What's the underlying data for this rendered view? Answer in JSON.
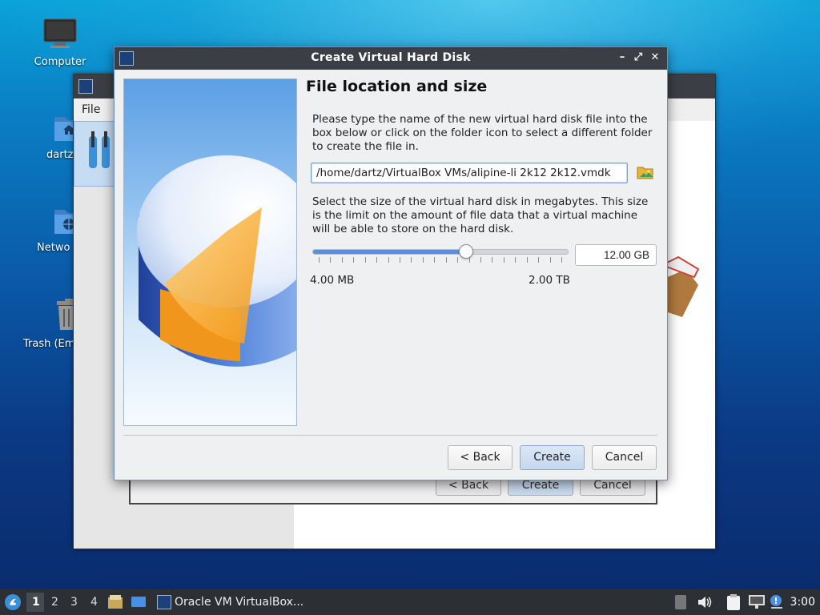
{
  "desktop": {
    "icons": [
      {
        "label": "Computer",
        "icon": "computer-icon"
      },
      {
        "label": "dartz",
        "icon": "home-folder-icon"
      },
      {
        "label": "Netwo",
        "icon": "network-folder-icon"
      },
      {
        "label": "Trash (Em",
        "icon": "trash-icon"
      }
    ]
  },
  "background_window": {
    "menu_file": "File",
    "back_label": "< Back",
    "create_label": "Create",
    "cancel_label": "Cancel"
  },
  "dialog": {
    "title": "Create Virtual Hard Disk",
    "minimize_glyph": "–",
    "maximize_glyph": "⤢",
    "close_glyph": "✕",
    "heading": "File location and size",
    "location_text": "Please type the name of the new virtual hard disk file into the box below or click on the folder icon to select a different folder to create the file in.",
    "file_path": "/home/dartz/VirtualBox VMs/alipine-li 2k12 2k12.vmdk",
    "size_text": "Select the size of the virtual hard disk in megabytes. This size is the limit on the amount of file data that a virtual machine will be able to store on the hard disk.",
    "slider_fraction": 0.6,
    "size_value": "12.00 GB",
    "min_label": "4.00 MB",
    "max_label": "2.00 TB",
    "back_label": "< Back",
    "create_label": "Create",
    "cancel_label": "Cancel"
  },
  "taskbar": {
    "workspaces": [
      "1",
      "2",
      "3",
      "4"
    ],
    "active_workspace": "1",
    "app_label": "Oracle VM VirtualBox...",
    "clock": "3:00"
  },
  "colors": {
    "accent": "#5b8fd0",
    "titlebar": "#3b3f45",
    "taskbar": "#2c3035"
  }
}
